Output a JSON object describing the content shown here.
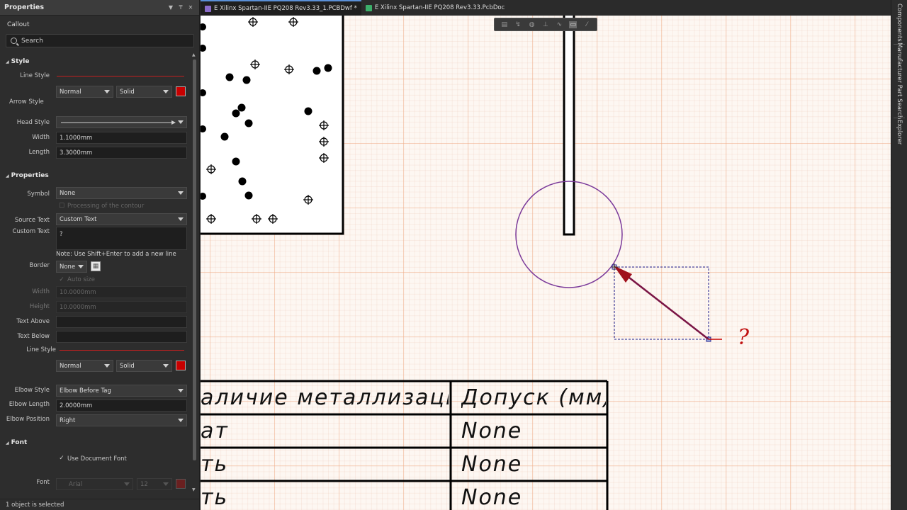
{
  "panel": {
    "title": "Properties",
    "header_icons": [
      "dropdown-icon",
      "pin-icon",
      "close-icon"
    ],
    "subtitle": "Callout",
    "search_placeholder": "Search",
    "style_section": {
      "title": "Style",
      "line_style_label": "Line Style",
      "line_weight": "Normal",
      "line_type": "Solid",
      "line_color": "#c80000",
      "arrow_style_label": "Arrow Style",
      "head_style_label": "Head Style",
      "width_label": "Width",
      "width_value": "1.1000mm",
      "length_label": "Length",
      "length_value": "3.3000mm"
    },
    "properties_section": {
      "title": "Properties",
      "symbol_label": "Symbol",
      "symbol_value": "None",
      "processing_label": "Processing of the contour",
      "source_text_label": "Source Text",
      "source_text_value": "Custom Text",
      "custom_text_label": "Custom Text",
      "custom_text_value": "?",
      "note": "Note: Use Shift+Enter to add a new line",
      "border_label": "Border",
      "border_value": "None",
      "auto_size_label": "Auto size",
      "width_label": "Width",
      "width_value": "10.0000mm",
      "height_label": "Height",
      "height_value": "10.0000mm",
      "text_above_label": "Text Above",
      "text_below_label": "Text Below",
      "line_style_label": "Line Style",
      "line_weight": "Normal",
      "line_type": "Solid",
      "elbow_style_label": "Elbow Style",
      "elbow_style_value": "Elbow Before Tag",
      "elbow_length_label": "Elbow Length",
      "elbow_length_value": "2.0000mm",
      "elbow_position_label": "Elbow Position",
      "elbow_position_value": "Right"
    },
    "font_section": {
      "title": "Font",
      "use_document_font_label": "Use Document Font",
      "font_label": "Font",
      "font_value": "Arial",
      "font_size": "12"
    },
    "status": "1 object is selected"
  },
  "tabs": [
    {
      "label": "E Xilinx Spartan-IIE PQ208 Rev3.33_1.PCBDwf *",
      "active": true,
      "icon": "pcb-drawing-icon",
      "icon_color": "#8a6cc9"
    },
    {
      "label": "E Xilinx Spartan-IIE PQ208 Rev3.33.PcbDoc",
      "active": false,
      "icon": "pcb-doc-icon",
      "icon_color": "#3cae6a"
    }
  ],
  "canvas": {
    "callout_text": "?",
    "accent_color": "#7a1545",
    "circle_color": "#7b3a9a",
    "table": {
      "headers": [
        "аличие металлизации",
        "Допуск (мм)"
      ],
      "rows": [
        [
          "ат",
          "None"
        ],
        [
          "ть",
          "None"
        ],
        [
          "ть",
          "None"
        ]
      ]
    }
  },
  "right_dock": [
    "Components",
    "Manufacturer Part Search",
    "Explorer"
  ]
}
